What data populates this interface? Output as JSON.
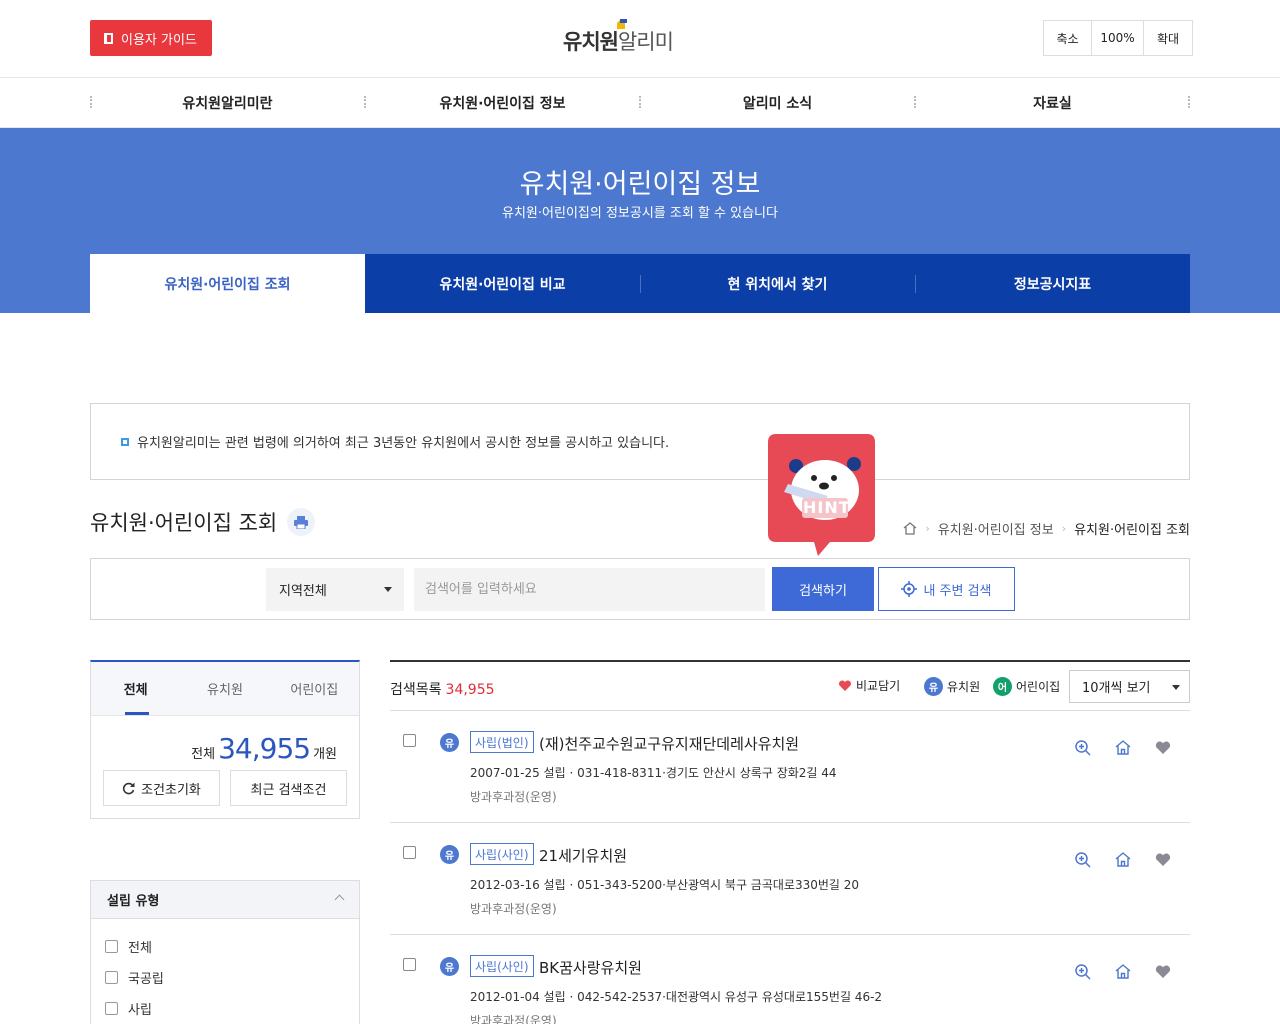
{
  "header": {
    "guide_label": "이용자 가이드",
    "logo_bold": "유치원",
    "logo_light": "알리미",
    "zoom_out": "축소",
    "zoom_level": "100%",
    "zoom_in": "확대"
  },
  "gnb": [
    "유치원알리미란",
    "유치원·어린이집 정보",
    "알리미 소식",
    "자료실"
  ],
  "hero": {
    "title": "유치원·어린이집 정보",
    "subtitle": "유치원·어린이집의 정보공시를 조회 할 수 있습니다",
    "tabs": [
      "유치원·어린이집 조회",
      "유치원·어린이집 비교",
      "현 위치에서 찾기",
      "정보공시지표"
    ]
  },
  "notice": "유치원알리미는 관련 법령에 의거하여 최근 3년동안 유치원에서 공시한 정보를 공시하고 있습니다.",
  "hint_label": "HINT",
  "page": {
    "title": "유치원·어린이집 조회",
    "breadcrumb": [
      "유치원·어린이집 정보",
      "유치원·어린이집 조회"
    ]
  },
  "search": {
    "region": "지역전체",
    "placeholder": "검색어를 입력하세요",
    "search_btn": "검색하기",
    "nearby_btn": "내 주변 검색"
  },
  "side": {
    "tabs": [
      "전체",
      "유치원",
      "어린이집"
    ],
    "total_prefix": "전체",
    "total_count": "34,955",
    "total_unit": "개원",
    "reset_btn": "조건초기화",
    "recent_btn": "최근 검색조건",
    "filter_title": "설립 유형",
    "filter_options": [
      "전체",
      "국공립",
      "사립"
    ]
  },
  "list": {
    "label": "검색목록",
    "count": "34,955",
    "compare_label": "비교담기",
    "kinder_label": "유치원",
    "daycare_label": "어린이집",
    "kinder_badge": "유",
    "daycare_badge": "어",
    "perpage": "10개씩 보기",
    "items": [
      {
        "badge": "유",
        "type": "사립(법인)",
        "name": "(재)천주교수원교구유지재단데레사유치원",
        "info": "2007-01-25 설립 · 031-418-8311·경기도 안산시 상록구 장화2길 44",
        "service": "방과후과정(운영)"
      },
      {
        "badge": "유",
        "type": "사립(사인)",
        "name": "21세기유치원",
        "info": "2012-03-16 설립 · 051-343-5200·부산광역시 북구 금곡대로330번길 20",
        "service": "방과후과정(운영)"
      },
      {
        "badge": "유",
        "type": "사립(사인)",
        "name": "BK꿈사랑유치원",
        "info": "2012-01-04 설립 · 042-542-2537·대전광역시 유성구 유성대로155번길 46-2",
        "service": "방과후과정(운영)"
      }
    ]
  },
  "colors": {
    "hero_bg": "#4d78d0",
    "tab_bar": "#0c3ea7",
    "primary": "#3d6ad6",
    "guide_red": "#e8383d",
    "count_red": "#e02d35"
  }
}
